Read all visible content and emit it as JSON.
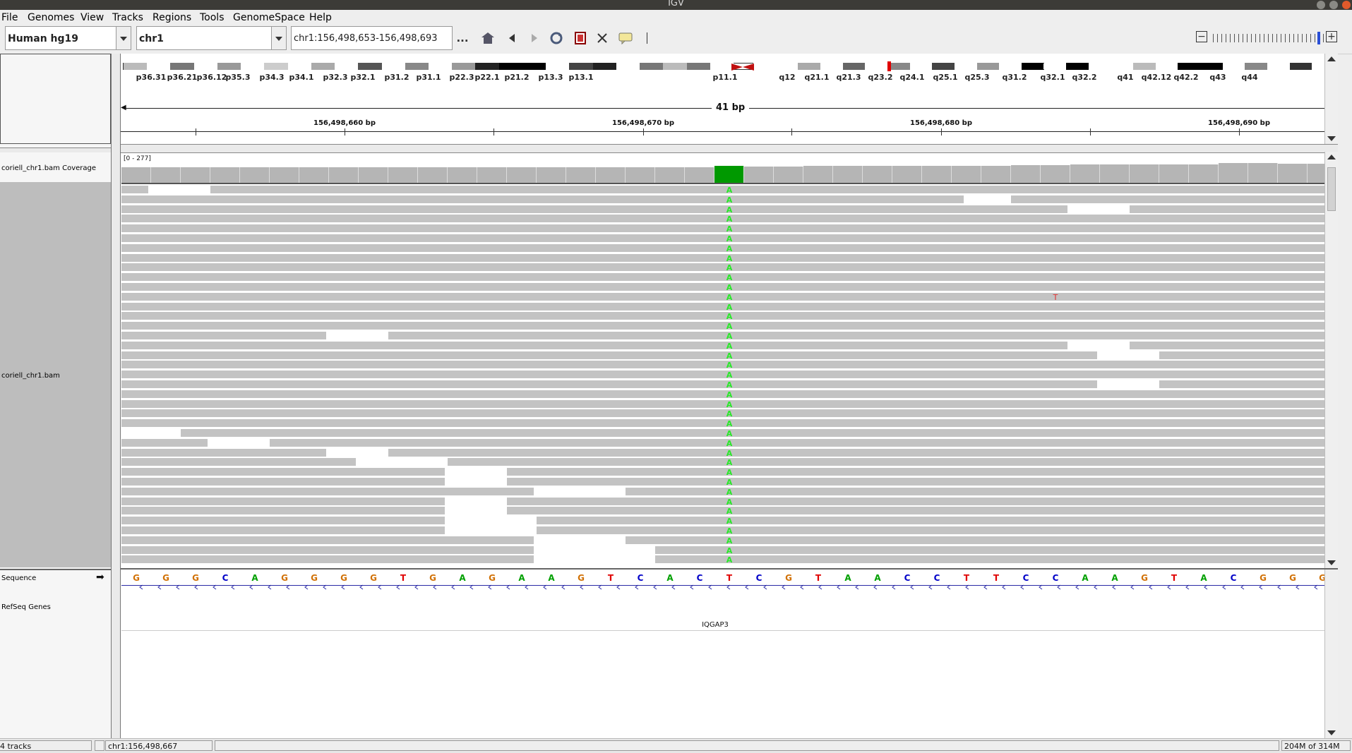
{
  "window": {
    "title": "IGV"
  },
  "menu": [
    "File",
    "Genomes",
    "View",
    "Tracks",
    "Regions",
    "Tools",
    "GenomeSpace",
    "Help"
  ],
  "toolbar": {
    "genome": "Human hg19",
    "chromosome": "chr1",
    "locus": "chr1:156,498,653-156,498,693",
    "ellipsis": "..."
  },
  "ideogram": {
    "bands": [
      "p36.31",
      "p36.21",
      "p36.12",
      "p35.3",
      "p34.3",
      "p34.1",
      "p32.3",
      "p32.1",
      "p31.2",
      "p31.1",
      "p22.3",
      "p22.1",
      "p21.2",
      "p13.3",
      "p13.1",
      "p11.1",
      "q12",
      "q21.1",
      "q21.3",
      "q23.2",
      "q24.1",
      "q25.1",
      "q25.3",
      "q31.2",
      "q32.1",
      "q32.2",
      "q41",
      "q42.12",
      "q42.2",
      "q43",
      "q44"
    ]
  },
  "ruler": {
    "span": "41 bp",
    "ticks": [
      "156,498,660 bp",
      "156,498,670 bp",
      "156,498,680 bp",
      "156,498,690 bp"
    ]
  },
  "tracks": {
    "coverage_name": "coriell_chr1.bam Coverage",
    "coverage_range": "[0 - 277]",
    "alignment_name": "coriell_chr1.bam",
    "sequence_name": "Sequence",
    "genes_name": "RefSeq Genes",
    "gene_label": "IQGAP3"
  },
  "sequence": [
    "G",
    "G",
    "G",
    "C",
    "A",
    "G",
    "G",
    "G",
    "G",
    "T",
    "G",
    "A",
    "G",
    "A",
    "A",
    "G",
    "T",
    "C",
    "A",
    "C",
    "T",
    "C",
    "G",
    "T",
    "A",
    "A",
    "C",
    "C",
    "T",
    "T",
    "C",
    "C",
    "A",
    "A",
    "G",
    "T",
    "A",
    "C",
    "G",
    "G",
    "G"
  ],
  "mismatch": {
    "base": "A",
    "color": "#00a000",
    "highlight_color": "#009900",
    "rare": "T"
  },
  "status": {
    "tracks": "4 tracks",
    "position": "chr1:156,498,667",
    "memory": "204M of 314M"
  },
  "colors": {
    "A": "#00a000",
    "C": "#0000c8",
    "G": "#d17105",
    "T": "#e00000"
  }
}
